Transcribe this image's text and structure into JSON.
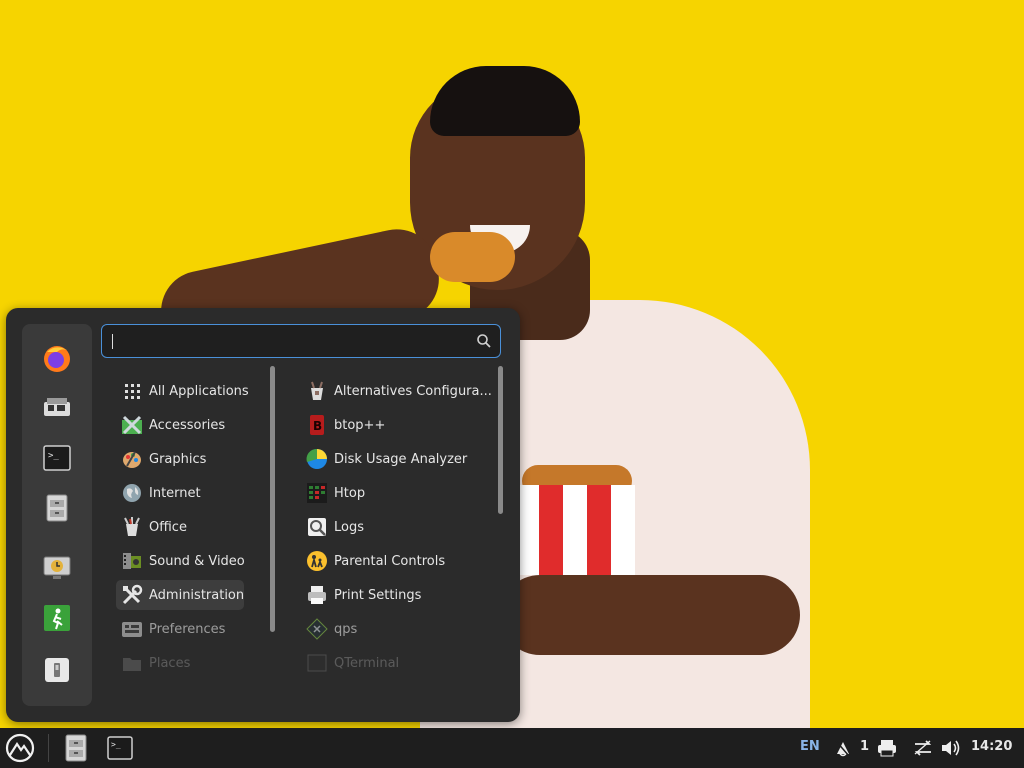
{
  "search": {
    "placeholder": "",
    "value": ""
  },
  "favorites": [
    "firefox-icon",
    "software-manager-icon",
    "terminal-icon",
    "file-manager-icon",
    "timeshift-icon",
    "logout-icon",
    "shutdown-icon"
  ],
  "categories": [
    {
      "label": "All Applications",
      "icon": "grid-icon"
    },
    {
      "label": "Accessories",
      "icon": "accessories-icon"
    },
    {
      "label": "Graphics",
      "icon": "graphics-icon"
    },
    {
      "label": "Internet",
      "icon": "internet-icon"
    },
    {
      "label": "Office",
      "icon": "office-icon"
    },
    {
      "label": "Sound & Video",
      "icon": "sound-video-icon"
    },
    {
      "label": "Administration",
      "icon": "administration-icon",
      "selected": true
    },
    {
      "label": "Preferences",
      "icon": "preferences-icon"
    },
    {
      "label": "Places",
      "icon": "places-icon"
    }
  ],
  "apps": [
    {
      "label": "Alternatives Configura...",
      "icon": "alternatives-icon"
    },
    {
      "label": "btop++",
      "icon": "btop-icon"
    },
    {
      "label": "Disk Usage Analyzer",
      "icon": "disk-usage-icon"
    },
    {
      "label": "Htop",
      "icon": "htop-icon"
    },
    {
      "label": "Logs",
      "icon": "logs-icon"
    },
    {
      "label": "Parental Controls",
      "icon": "parental-controls-icon"
    },
    {
      "label": "Print Settings",
      "icon": "printer-icon"
    },
    {
      "label": "qps",
      "icon": "qps-icon"
    },
    {
      "label": "QTerminal",
      "icon": "qterminal-icon"
    }
  ],
  "taskbar": {
    "keyboard_layout": "EN",
    "notifications_count": "1",
    "clock": "14:20"
  },
  "colors": {
    "accent": "#4a90d9",
    "wallpaper": "#f6d400",
    "menu_bg": "#2b2b2b",
    "taskbar_bg": "#1e1e1e"
  }
}
